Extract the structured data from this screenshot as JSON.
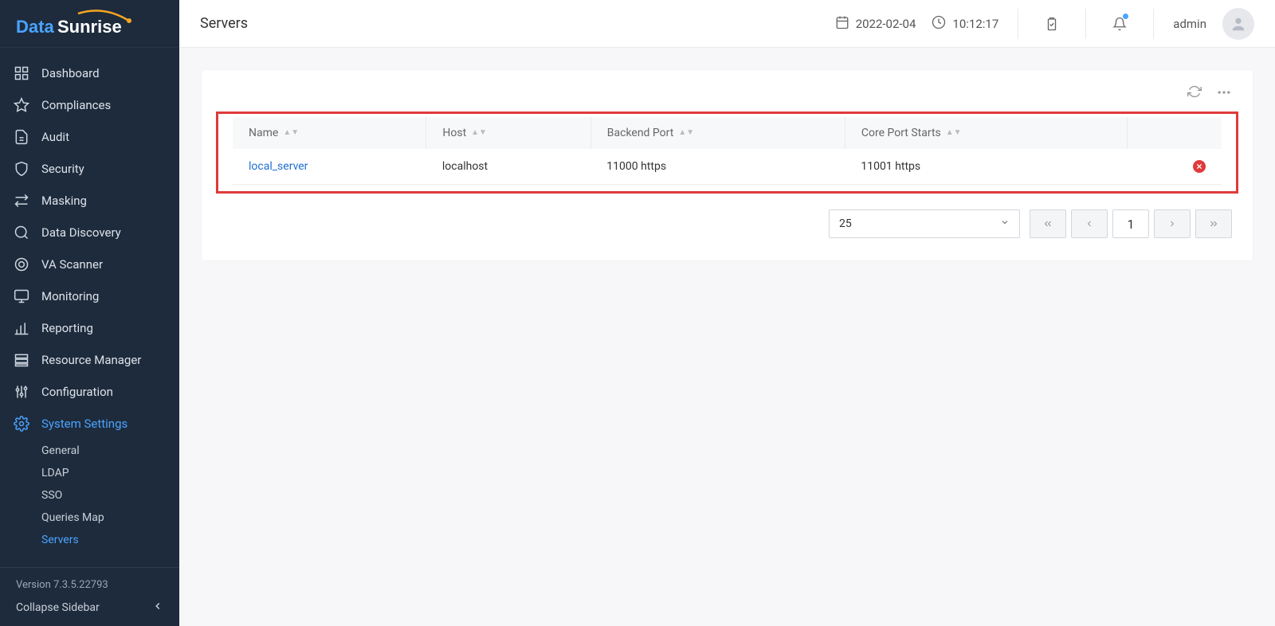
{
  "header": {
    "page_title": "Servers",
    "date": "2022-02-04",
    "time": "10:12:17",
    "user": "admin"
  },
  "sidebar": {
    "items": [
      {
        "label": "Dashboard"
      },
      {
        "label": "Compliances"
      },
      {
        "label": "Audit"
      },
      {
        "label": "Security"
      },
      {
        "label": "Masking"
      },
      {
        "label": "Data Discovery"
      },
      {
        "label": "VA Scanner"
      },
      {
        "label": "Monitoring"
      },
      {
        "label": "Reporting"
      },
      {
        "label": "Resource Manager"
      },
      {
        "label": "Configuration"
      },
      {
        "label": "System Settings"
      }
    ],
    "system_settings_children": [
      {
        "label": "General"
      },
      {
        "label": "LDAP"
      },
      {
        "label": "SSO"
      },
      {
        "label": "Queries Map"
      },
      {
        "label": "Servers"
      }
    ],
    "version": "Version 7.3.5.22793",
    "collapse_label": "Collapse Sidebar"
  },
  "table": {
    "columns": [
      "Name",
      "Host",
      "Backend Port",
      "Core Port Starts"
    ],
    "rows": [
      {
        "name": "local_server",
        "host": "localhost",
        "backend_port": "11000 https",
        "core_port_starts": "11001 https"
      }
    ]
  },
  "pagination": {
    "page_size": "25",
    "current_page": "1"
  }
}
